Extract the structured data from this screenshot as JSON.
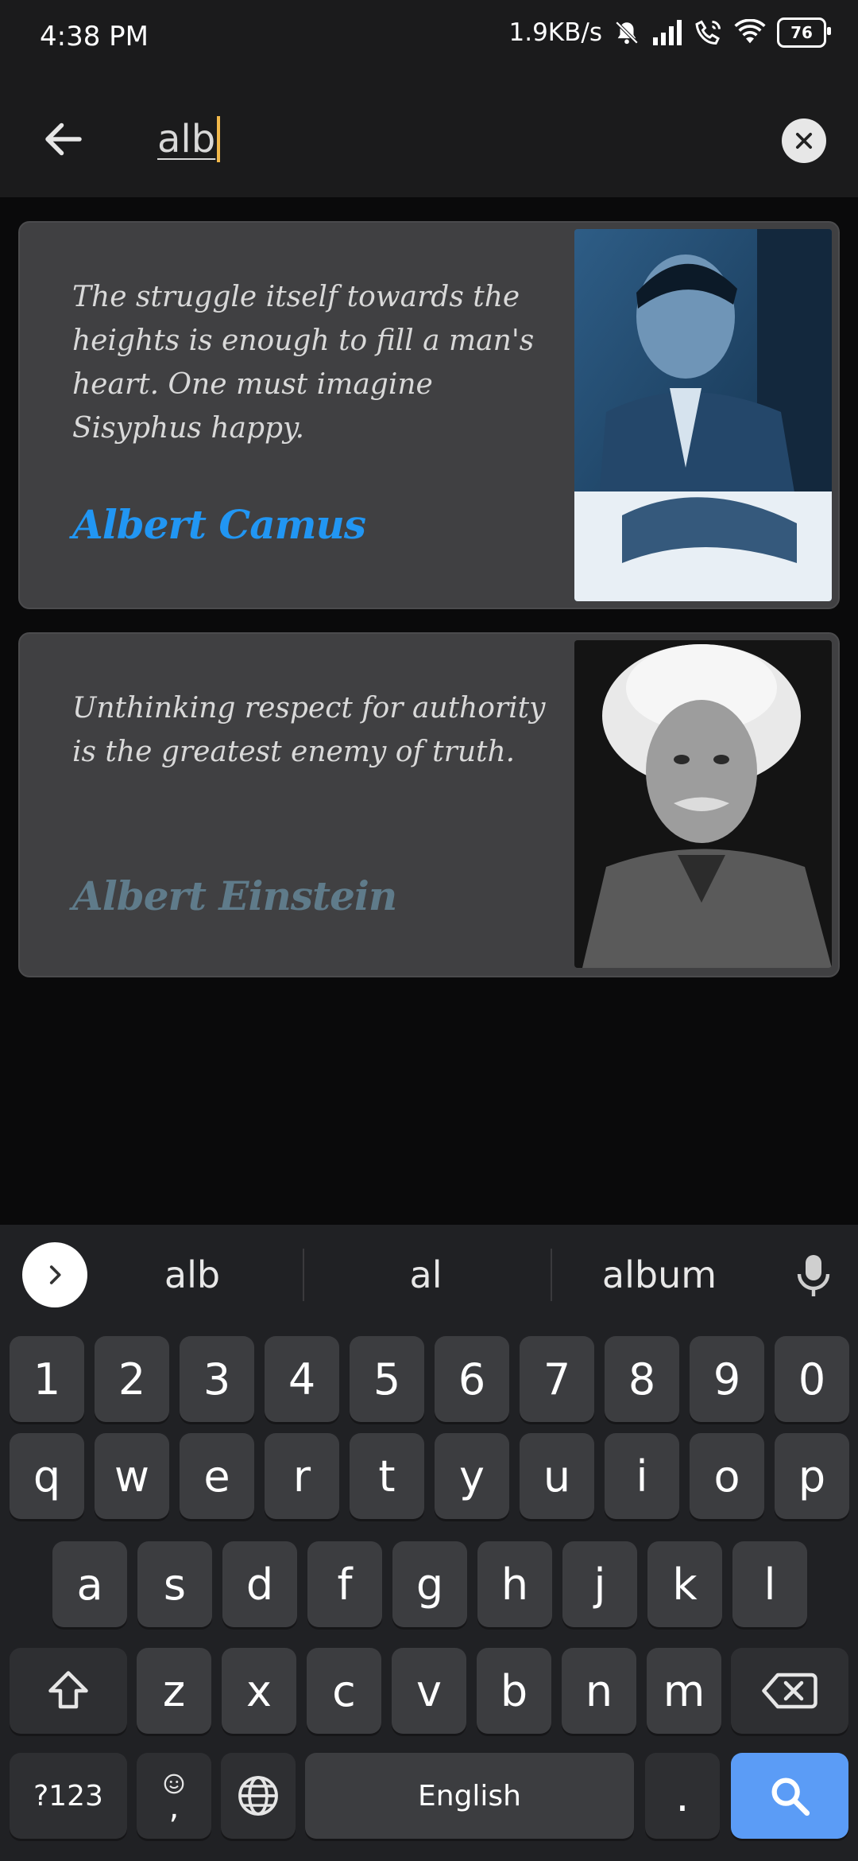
{
  "status_bar": {
    "time": "4:38 PM",
    "net_speed": "1.9KB/s",
    "battery": "76",
    "icons": [
      "mute-bell-icon",
      "signal-icon",
      "wifi-call-icon",
      "wifi-icon",
      "battery-icon"
    ]
  },
  "search": {
    "query": "alb",
    "back_icon": "arrow-left-icon",
    "clear_icon": "close-circle-icon"
  },
  "results": [
    {
      "quote": "The struggle itself towards the heights is enough to fill a man's heart. One must imagine Sisyphus happy.",
      "author": "Albert Camus",
      "author_color": "#2196f3"
    },
    {
      "quote": "Unthinking respect for authority is the greatest enemy of truth.",
      "author": "Albert Einstein",
      "author_color": "#5f7b8a"
    }
  ],
  "keyboard": {
    "suggestions": [
      "alb",
      "al",
      "album"
    ],
    "number_row": [
      "1",
      "2",
      "3",
      "4",
      "5",
      "6",
      "7",
      "8",
      "9",
      "0"
    ],
    "row1": [
      "q",
      "w",
      "e",
      "r",
      "t",
      "y",
      "u",
      "i",
      "o",
      "p"
    ],
    "row2": [
      "a",
      "s",
      "d",
      "f",
      "g",
      "h",
      "j",
      "k",
      "l"
    ],
    "row3": [
      "z",
      "x",
      "c",
      "v",
      "b",
      "n",
      "m"
    ],
    "symbols_label": "?123",
    "comma_label": ",",
    "space_label": "English",
    "period_label": ".",
    "accent_color": "#5b9cf6"
  }
}
